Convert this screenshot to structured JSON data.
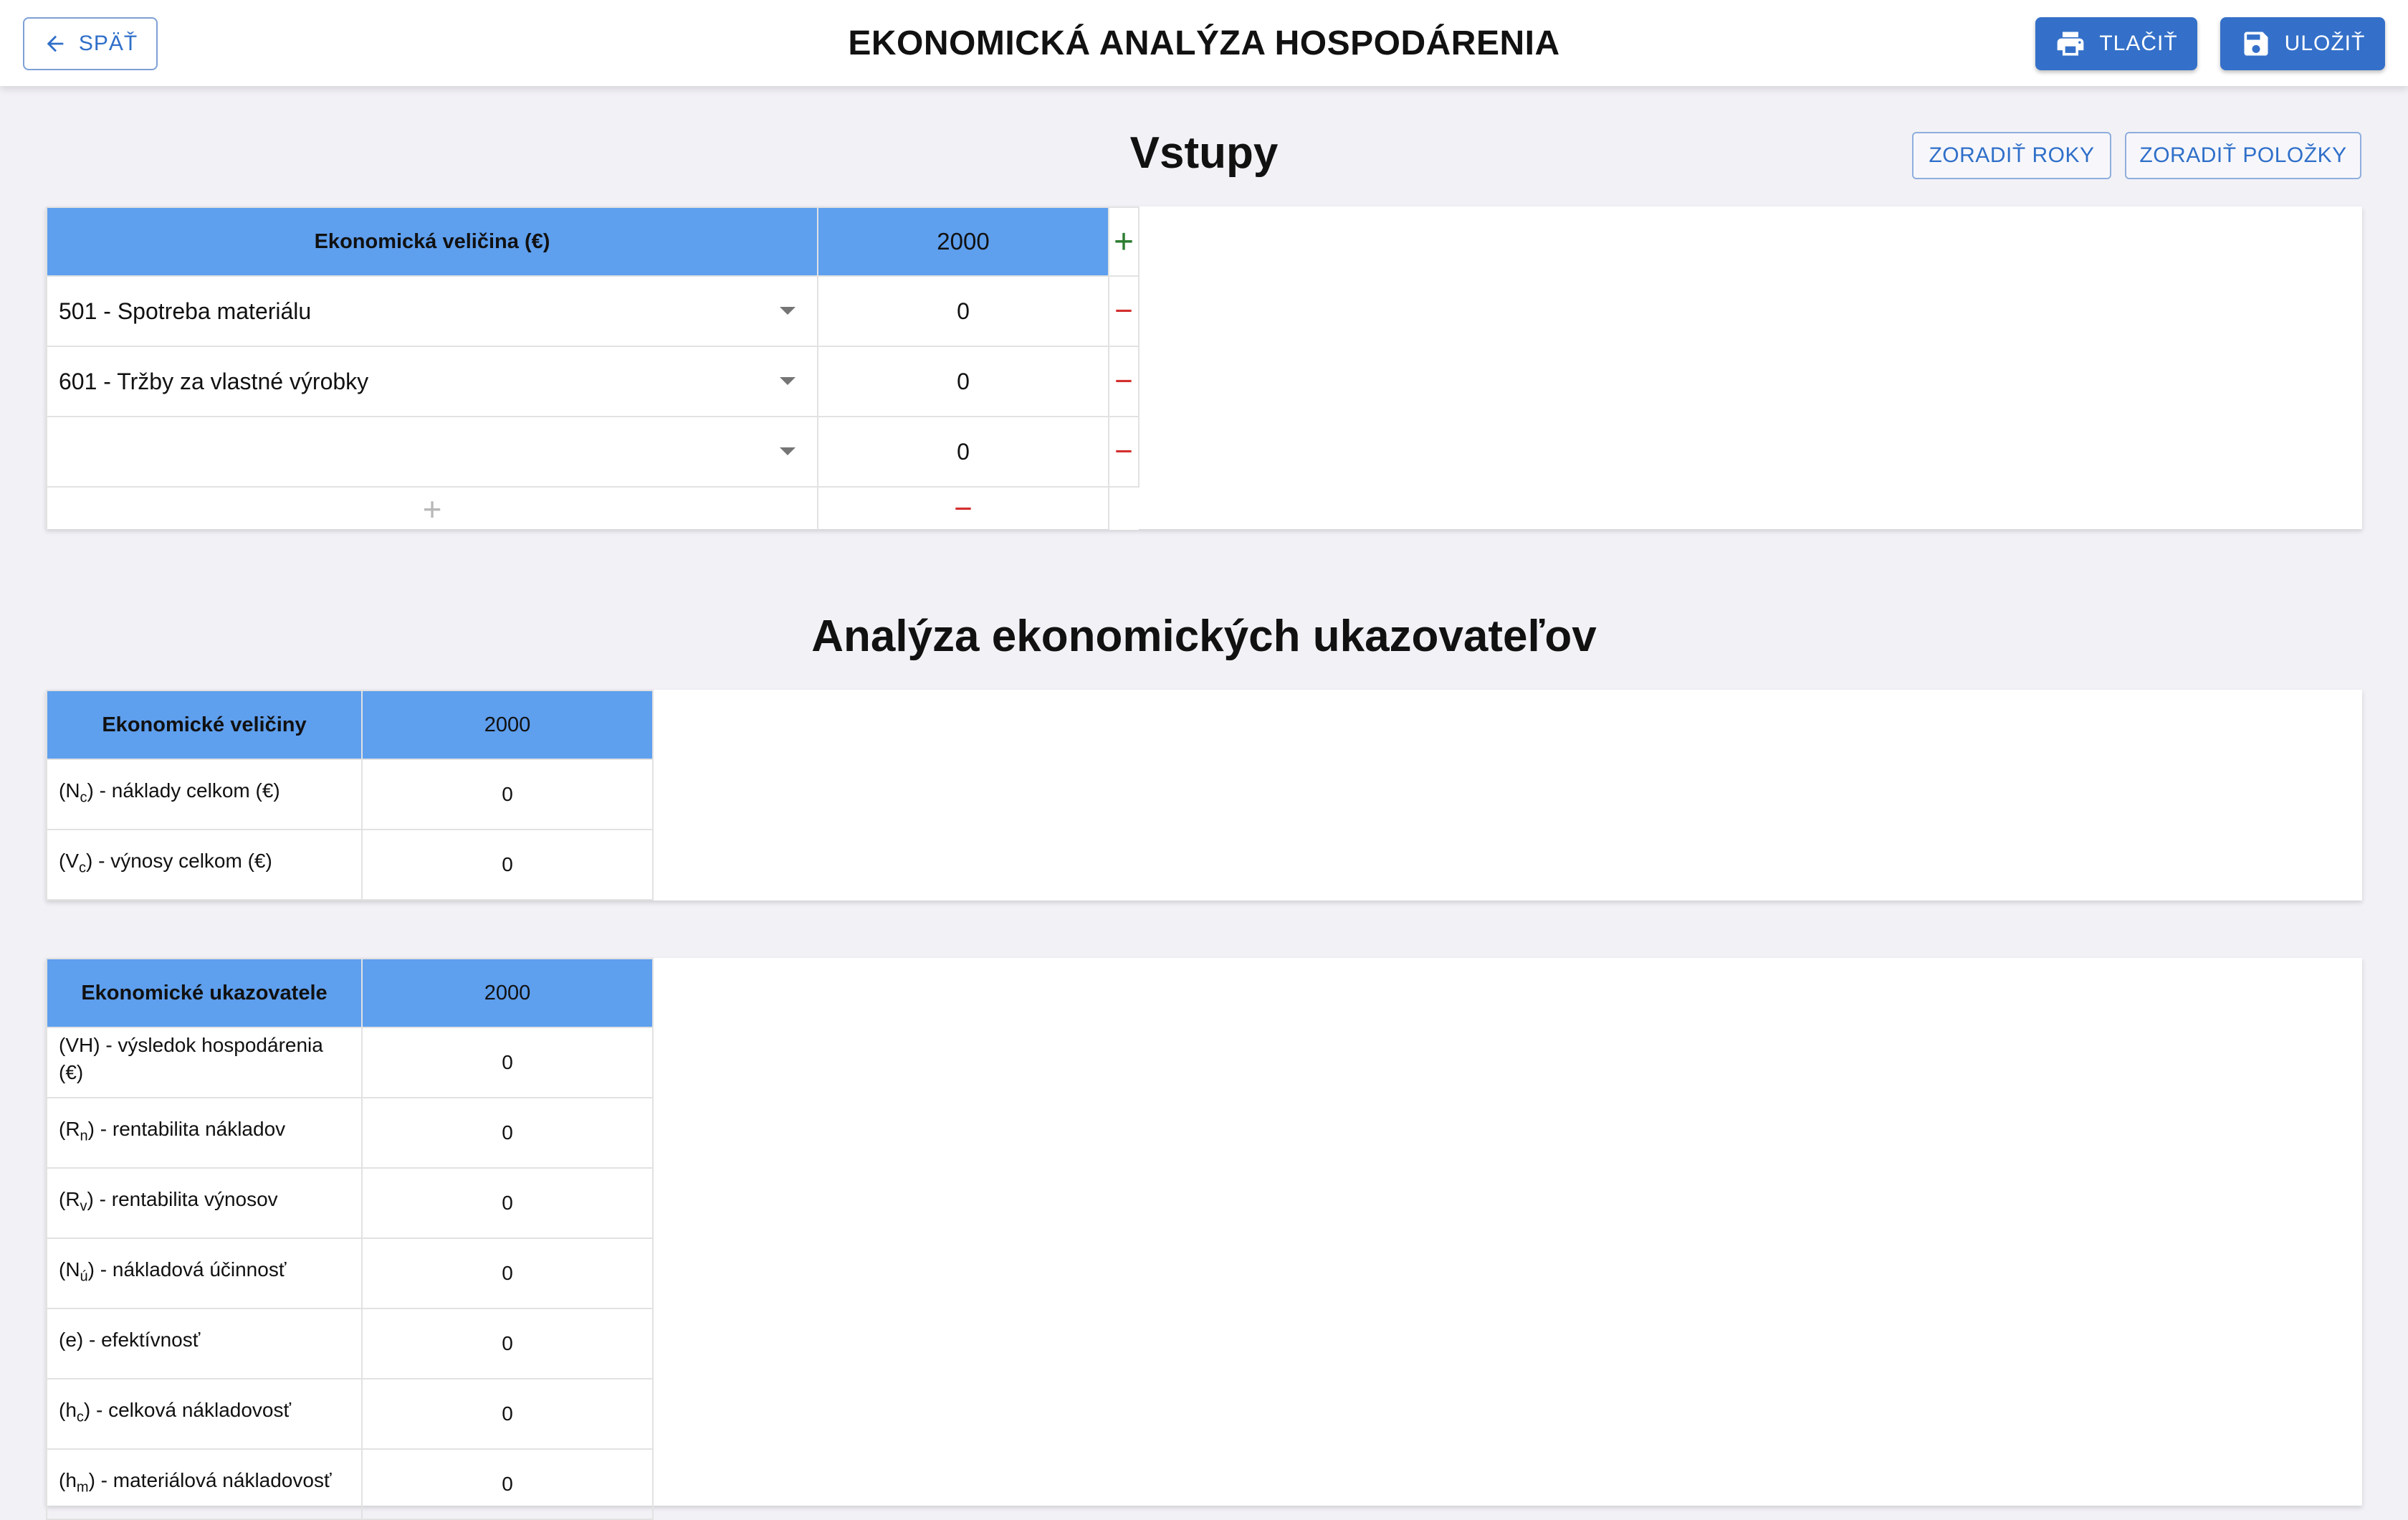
{
  "header": {
    "back_label": "SPÄŤ",
    "title": "EKONOMICKÁ ANALÝZA HOSPODÁRENIA",
    "print_label": "TLAČIŤ",
    "save_label": "ULOŽIŤ"
  },
  "inputs": {
    "title": "Vstupy",
    "sort_years_label": "ZORADIŤ ROKY",
    "sort_items_label": "ZORADIŤ POLOŽKY",
    "col_label": "Ekonomická veličina (€)",
    "year": "2000",
    "rows": [
      {
        "label": "501 - Spotreba materiálu",
        "value": "0"
      },
      {
        "label": "601 - Tržby za vlastné výrobky",
        "value": "0"
      },
      {
        "label": "",
        "value": "0"
      }
    ]
  },
  "analysis": {
    "title": "Analýza ekonomických ukazovateľov",
    "quantities": {
      "col_label": "Ekonomické veličiny",
      "year": "2000",
      "rows": [
        {
          "prefix": "(N",
          "sub": "c",
          "suffix": ") - náklady celkom (€)",
          "value": "0"
        },
        {
          "prefix": "(V",
          "sub": "c",
          "suffix": ") - výnosy celkom (€)",
          "value": "0"
        }
      ]
    },
    "indicators": {
      "col_label": "Ekonomické ukazovatele",
      "year": "2000",
      "rows": [
        {
          "prefix": "(VH) - výsledok hospodárenia (€)",
          "sub": "",
          "suffix": "",
          "value": "0"
        },
        {
          "prefix": "(R",
          "sub": "n",
          "suffix": ") - rentabilita nákladov",
          "value": "0"
        },
        {
          "prefix": "(R",
          "sub": "v",
          "suffix": ") - rentabilita výnosov",
          "value": "0"
        },
        {
          "prefix": "(N",
          "sub": "ú",
          "suffix": ") - nákladová účinnosť",
          "value": "0"
        },
        {
          "prefix": "(e) - efektívnosť",
          "sub": "",
          "suffix": "",
          "value": "0"
        },
        {
          "prefix": "(h",
          "sub": "c",
          "suffix": ") - celková nákladovosť",
          "value": "0"
        },
        {
          "prefix": "(h",
          "sub": "m",
          "suffix": ") - materiálová nákladovosť",
          "value": "0"
        }
      ]
    }
  },
  "icons": {
    "back": "arrow-left-icon",
    "print": "printer-icon",
    "save": "floppy-disk-icon",
    "add": "plus-icon",
    "remove": "minus-icon",
    "dropdown": "caret-down-icon"
  },
  "colors": {
    "accent": "#3470c9",
    "table_header": "#5e9fee",
    "add_green": "#2e7d32",
    "remove_red": "#d32f2f",
    "background": "#f2f1f6"
  }
}
